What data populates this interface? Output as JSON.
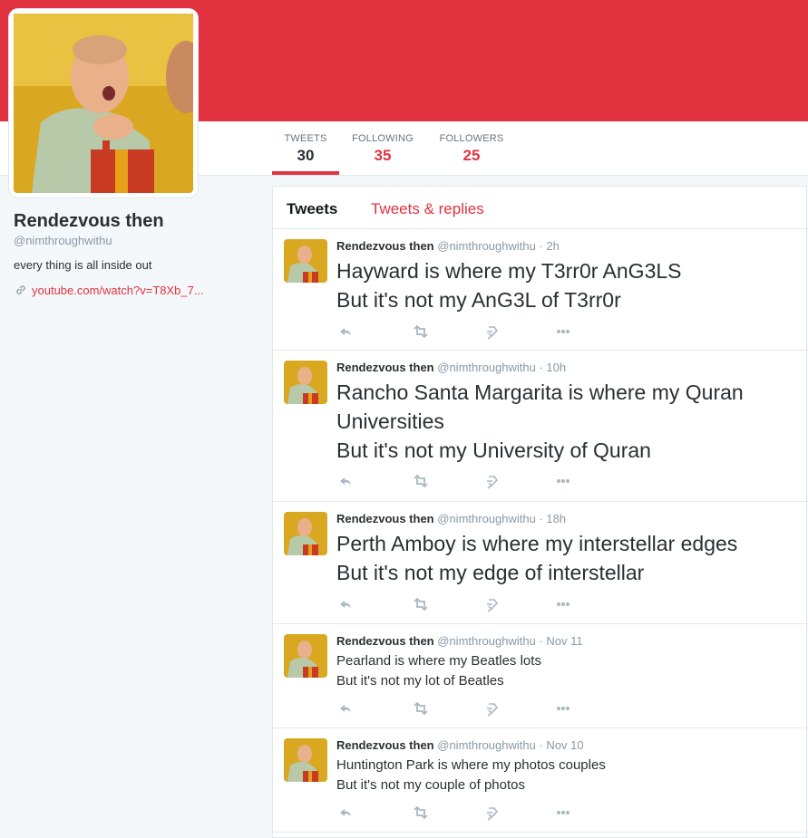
{
  "profile": {
    "name": "Rendezvous then",
    "handle": "@nimthroughwithu",
    "bio": "every thing is all inside out",
    "link": "youtube.com/watch?v=T8Xb_7..."
  },
  "stats": [
    {
      "label": "TWEETS",
      "value": "30"
    },
    {
      "label": "FOLLOWING",
      "value": "35"
    },
    {
      "label": "FOLLOWERS",
      "value": "25"
    }
  ],
  "tabs": {
    "tweets": "Tweets",
    "replies": "Tweets & replies"
  },
  "tweets": [
    {
      "name": "Rendezvous then",
      "meta": "@nimthroughwithu · 2h",
      "lines": [
        "Hayward is where my T3rr0r AnG3LS",
        "But it's not my AnG3L of T3rr0r"
      ]
    },
    {
      "name": "Rendezvous then",
      "meta": "@nimthroughwithu · 10h",
      "lines": [
        "Rancho Santa Margarita is where my Quran",
        "Universities",
        "But it's not my University of Quran"
      ]
    },
    {
      "name": "Rendezvous then",
      "meta": "@nimthroughwithu · 18h",
      "lines": [
        "Perth Amboy is where my interstellar edges",
        "But it's not my edge of interstellar"
      ]
    },
    {
      "name": "Rendezvous then",
      "meta": "@nimthroughwithu · Nov 11",
      "lines": [
        "Pearland is where my Beatles lots",
        "But it's not my lot of Beatles"
      ]
    },
    {
      "name": "Rendezvous then",
      "meta": "@nimthroughwithu · Nov 10",
      "lines": [
        "Huntington Park is where my photos couples",
        "But it's not my couple of photos"
      ]
    }
  ],
  "colors": {
    "accent": "#e0323f",
    "text": "#292f33",
    "muted": "#8899a6"
  },
  "icons": [
    "reply-icon",
    "retweet-icon",
    "favorite-icon",
    "more-icon",
    "link-icon"
  ]
}
